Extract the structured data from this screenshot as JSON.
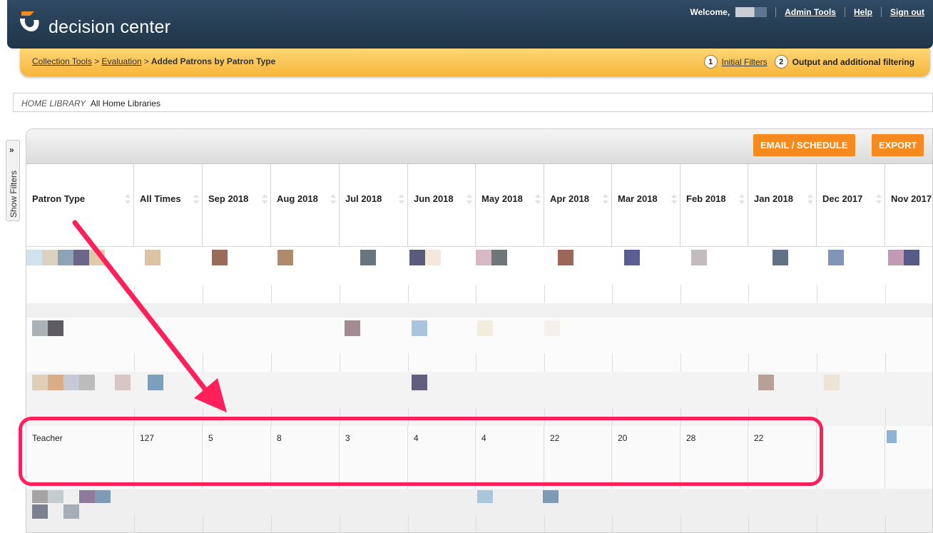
{
  "header": {
    "app_name": "decision center",
    "welcome_label": "Welcome,",
    "links": [
      "Admin Tools",
      "Help",
      "Sign out"
    ]
  },
  "breadcrumb": {
    "items": [
      "Collection Tools",
      "Evaluation"
    ],
    "current": "Added Patrons by Patron Type",
    "separator": ">"
  },
  "steps": [
    {
      "num": "1",
      "label": "Initial Filters"
    },
    {
      "num": "2",
      "label": "Output and additional filtering"
    }
  ],
  "filter": {
    "label": "HOME LIBRARY",
    "value": "All Home Libraries"
  },
  "show_filters": {
    "chevron": "»",
    "label": "Show Filters"
  },
  "toolbar": {
    "email_label": "EMAIL / SCHEDULE",
    "export_label": "EXPORT"
  },
  "table": {
    "columns": [
      "Patron Type",
      "All Times",
      "Sep 2018",
      "Aug 2018",
      "Jul 2018",
      "Jun 2018",
      "May 2018",
      "Apr 2018",
      "Mar 2018",
      "Feb 2018",
      "Jan 2018",
      "Dec 2017",
      "Nov 2017"
    ],
    "highlighted_row": [
      "Teacher",
      "127",
      "5",
      "8",
      "3",
      "4",
      "4",
      "22",
      "20",
      "28",
      "22",
      "",
      ""
    ]
  },
  "colors": {
    "header_bg": "#1f3549",
    "crumb_bar": "#f6b53a",
    "button_orange": "#f68a1e",
    "annotation_pink": "#ff1f5a"
  }
}
